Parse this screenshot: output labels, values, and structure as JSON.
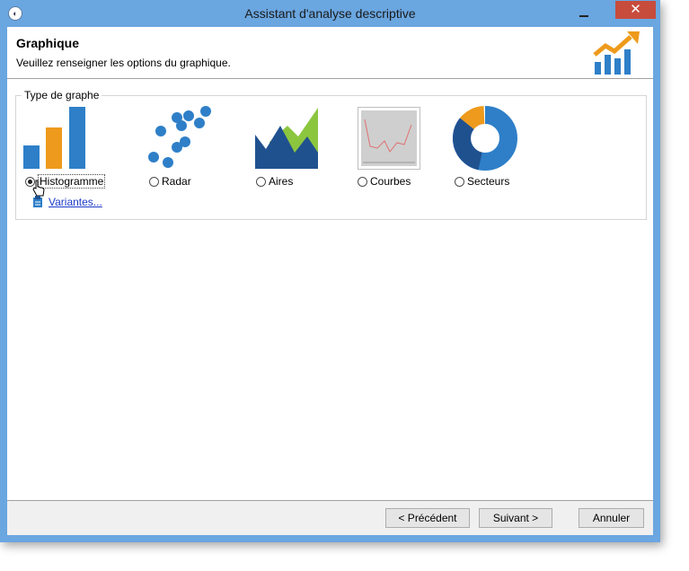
{
  "window": {
    "title": "Assistant d'analyse descriptive",
    "close_glyph": "✕"
  },
  "header": {
    "title": "Graphique",
    "subtitle": "Veuillez renseigner les options du graphique."
  },
  "group": {
    "label": "Type de graphe"
  },
  "chart_types": [
    {
      "label": "Histogramme",
      "checked": true
    },
    {
      "label": "Radar",
      "checked": false
    },
    {
      "label": "Aires",
      "checked": false
    },
    {
      "label": "Courbes",
      "checked": false
    },
    {
      "label": "Secteurs",
      "checked": false
    }
  ],
  "variantes": {
    "label": "Variantes..."
  },
  "footer": {
    "previous": "< Précédent",
    "next": "Suivant >",
    "cancel": "Annuler"
  },
  "colors": {
    "titlebar": "#6aa6e0",
    "blue": "#2e7fc8",
    "orange": "#ee9a1c",
    "green": "#8cc63f",
    "navy": "#20518f"
  }
}
